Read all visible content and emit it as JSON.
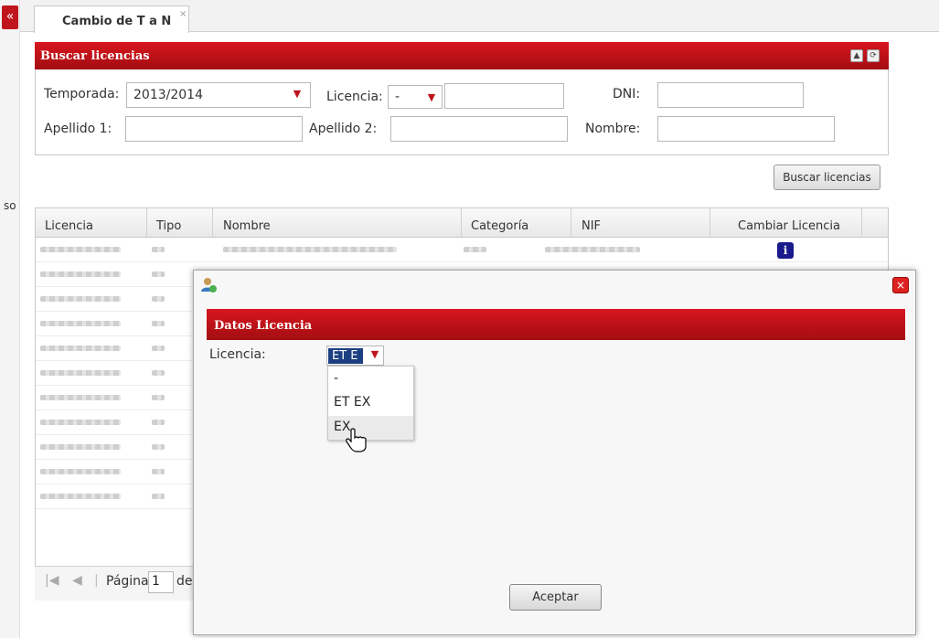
{
  "sidebar": {
    "collapse_glyph": "«",
    "cut_text": "so"
  },
  "tabs": [
    {
      "label": "Cambio de T a N",
      "close_glyph": "×"
    }
  ],
  "search_panel": {
    "title": "Buscar licencias",
    "collapse_icon": "chevron-up-icon",
    "refresh_icon": "refresh-icon",
    "temporada_label": "Temporada:",
    "temporada_value": "2013/2014",
    "licencia_label": "Licencia:",
    "licencia_value": "-",
    "licencia_text_value": "",
    "dni_label": "DNI:",
    "dni_value": "",
    "apellido1_label": "Apellido 1:",
    "apellido1_value": "",
    "apellido2_label": "Apellido 2:",
    "apellido2_value": "",
    "nombre_label": "Nombre:",
    "nombre_value": "",
    "search_button": "Buscar licencias"
  },
  "grid": {
    "columns": [
      "Licencia",
      "Tipo",
      "Nombre",
      "Categoría",
      "NIF",
      "Cambiar Licencia"
    ],
    "row_count": 11
  },
  "pager": {
    "page_label": "Página",
    "page_value": "1",
    "of_label": "de"
  },
  "dialog": {
    "section_title": "Datos Licencia",
    "licencia_label": "Licencia:",
    "select_value": "ET E",
    "options": [
      "-",
      "ET EX",
      "EX"
    ],
    "hovered_option": "EX",
    "accept_button": "Aceptar"
  },
  "colors": {
    "brand_red": "#c0151d",
    "selection_blue": "#1c3f82"
  }
}
